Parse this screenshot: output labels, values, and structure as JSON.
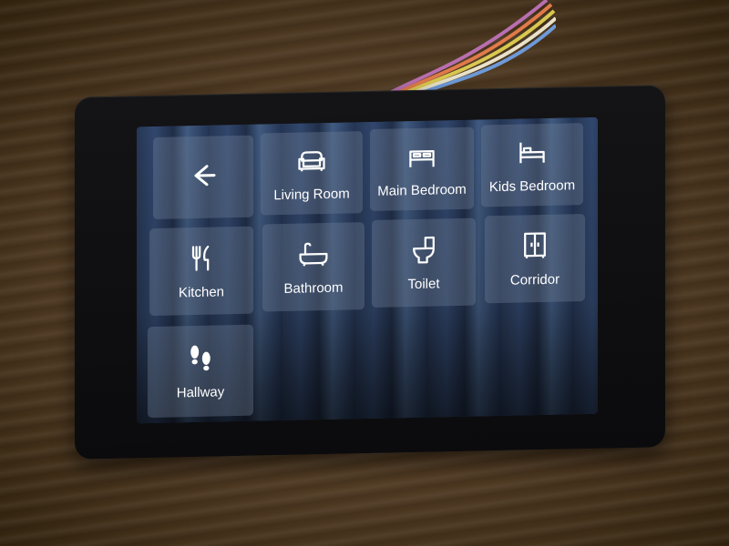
{
  "screen": {
    "tiles": [
      {
        "label": "",
        "icon": "arrow-left-icon"
      },
      {
        "label": "Living Room",
        "icon": "sofa-icon"
      },
      {
        "label": "Main Bedroom",
        "icon": "double-bed-icon"
      },
      {
        "label": "Kids Bedroom",
        "icon": "single-bed-icon"
      },
      {
        "label": "Kitchen",
        "icon": "fork-knife-icon"
      },
      {
        "label": "Bathroom",
        "icon": "bathtub-icon"
      },
      {
        "label": "Toilet",
        "icon": "toilet-icon"
      },
      {
        "label": "Corridor",
        "icon": "wardrobe-icon"
      },
      {
        "label": "Hallway",
        "icon": "footprints-icon"
      }
    ]
  },
  "colors": {
    "tile_text": "#ffffff",
    "tile_bg": "#6e7d96",
    "bezel": "#111113"
  }
}
